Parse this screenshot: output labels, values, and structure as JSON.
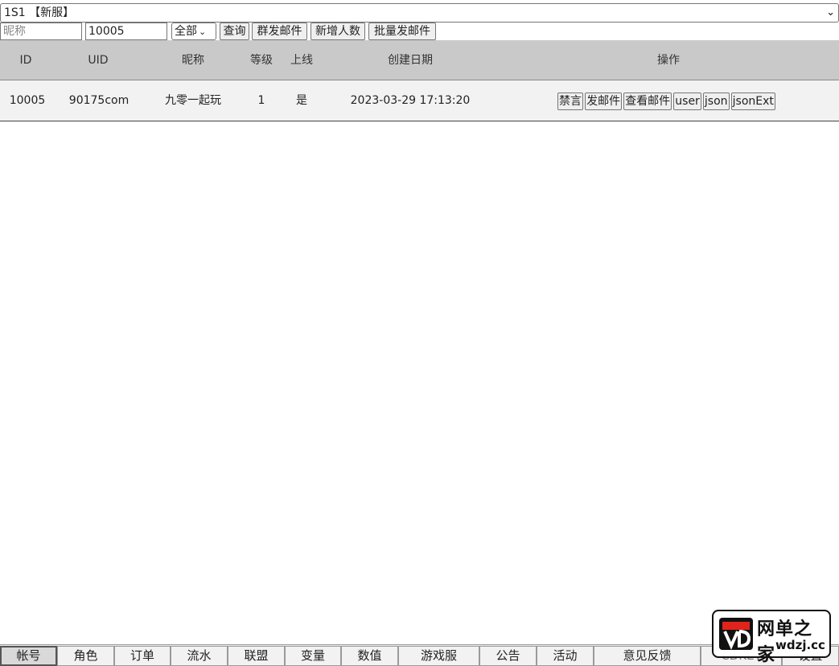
{
  "server_select": {
    "value": "1S1 【新服】"
  },
  "toolbar": {
    "nickname_placeholder": "昵称",
    "uid_value": "10005",
    "filter_value": "全部",
    "query_label": "查询",
    "mass_mail_label": "群发邮件",
    "new_users_label": "新增人数",
    "batch_mail_label": "批量发邮件"
  },
  "table": {
    "headers": {
      "id": "ID",
      "uid": "UID",
      "nickname": "昵称",
      "level": "等级",
      "online": "上线",
      "created": "创建日期",
      "actions": "操作"
    },
    "rows": [
      {
        "id": "10005",
        "uid": "90175com",
        "nickname": "九零一起玩",
        "level": "1",
        "online": "是",
        "created": "2023-03-29 17:13:20",
        "actions": [
          "禁言",
          "发邮件",
          "查看邮件",
          "user",
          "json",
          "jsonExt"
        ]
      }
    ]
  },
  "bottom_tabs": [
    "帐号",
    "角色",
    "订单",
    "流水",
    "联盟",
    "变量",
    "数值",
    "游戏服",
    "公告",
    "活动",
    "意见反馈",
    "CDKEY",
    "设置"
  ],
  "active_tab": "帐号",
  "watermark": {
    "title": "网单之家",
    "subtitle": "wdzj.cc"
  },
  "colors": {
    "header_bg": "#c9c9c9",
    "row_bg": "#f2f2f2",
    "logo_red": "#e0241b"
  }
}
